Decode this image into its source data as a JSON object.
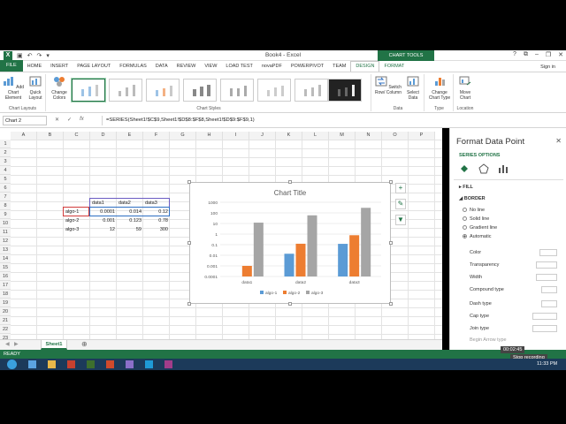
{
  "window": {
    "title": "Book4 - Excel",
    "chart_tools_label": "CHART TOOLS",
    "signin": "Sign in"
  },
  "tabs": [
    "FILE",
    "HOME",
    "INSERT",
    "PAGE LAYOUT",
    "FORMULAS",
    "DATA",
    "REVIEW",
    "VIEW",
    "LOAD TEST",
    "novaPDF",
    "POWERPIVOT",
    "TEAM",
    "DESIGN",
    "FORMAT"
  ],
  "ribbon": {
    "add_chart_element": "Add Chart Element",
    "quick_layout": "Quick Layout",
    "change_colors": "Change Colors",
    "group_chart_layouts": "Chart Layouts",
    "group_chart_styles": "Chart Styles",
    "switch_row_col": "Switch Row/ Column",
    "select_data": "Select Data",
    "group_data": "Data",
    "change_chart_type": "Change Chart Type",
    "group_type": "Type",
    "move_chart": "Move Chart",
    "group_location": "Location"
  },
  "formula_bar": {
    "name_box": "Chart 2",
    "formula": "=SERIES(Sheet1!$C$9,Sheet1!$D$8:$F$8,Sheet1!$D$9:$F$9,1)"
  },
  "columns": [
    "A",
    "B",
    "C",
    "D",
    "E",
    "F",
    "G",
    "H",
    "I",
    "J",
    "K",
    "L",
    "M",
    "N",
    "O",
    "P"
  ],
  "rows": [
    "1",
    "2",
    "3",
    "4",
    "5",
    "6",
    "7",
    "8",
    "9",
    "10",
    "11",
    "12",
    "13",
    "14",
    "15",
    "16",
    "17",
    "18",
    "19",
    "20",
    "21",
    "22",
    "23",
    "24"
  ],
  "table": {
    "headers": [
      "data1",
      "data2",
      "data3"
    ],
    "rows": [
      {
        "label": "algo-1",
        "values": [
          "0.0001",
          "0.014",
          "0.12"
        ]
      },
      {
        "label": "algo-2",
        "values": [
          "0.001",
          "0.123",
          "0.78"
        ]
      },
      {
        "label": "algo-3",
        "values": [
          "12",
          "59",
          "300"
        ]
      }
    ]
  },
  "chart_data": {
    "type": "bar",
    "title": "Chart Title",
    "categories": [
      "data1",
      "data2",
      "data3"
    ],
    "series": [
      {
        "name": "algo-1",
        "color": "#5b9bd5",
        "values": [
          0.0001,
          0.014,
          0.12
        ]
      },
      {
        "name": "algo-2",
        "color": "#ed7d31",
        "values": [
          0.001,
          0.123,
          0.78
        ]
      },
      {
        "name": "algo-3",
        "color": "#a5a5a5",
        "values": [
          12,
          59,
          300
        ]
      }
    ],
    "y_scale": "log",
    "y_ticks": [
      "1000",
      "100",
      "10",
      "1",
      "0.1",
      "0.01",
      "0.001",
      "0.0001"
    ],
    "ylim": [
      0.0001,
      1000
    ],
    "legend": "bottom",
    "grid": true
  },
  "sheet_tabs": [
    "Sheet1"
  ],
  "status": {
    "ready": "READY",
    "timer": "00:02:45",
    "stop_recording": "Stop recording",
    "clock": "11:33 PM"
  },
  "pane": {
    "title": "Format Data Point",
    "series_options": "SERIES OPTIONS",
    "fill": "FILL",
    "border": "BORDER",
    "border_options": [
      "No line",
      "Solid line",
      "Gradient line",
      "Automatic"
    ],
    "props": [
      "Color",
      "Transparency",
      "Width",
      "Compound type",
      "Dash type",
      "Cap type",
      "Join type",
      "Begin Arrow type"
    ]
  },
  "colors": {
    "accent": "#217346",
    "status": "#217346"
  }
}
